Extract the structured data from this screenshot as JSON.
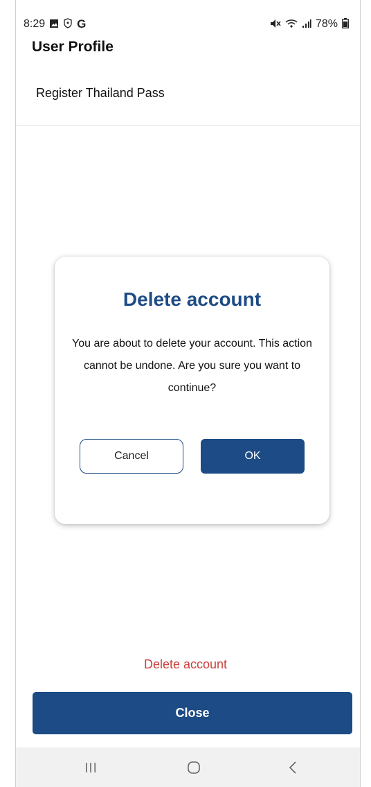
{
  "status_bar": {
    "time": "8:29",
    "battery": "78%",
    "icons": [
      "gallery-icon",
      "shield-icon",
      "google-icon",
      "mute-icon",
      "wifi-icon",
      "signal-icon",
      "battery-icon"
    ]
  },
  "header": {
    "title": "User Profile"
  },
  "menu": {
    "register_label": "Register Thailand Pass"
  },
  "dialog": {
    "title": "Delete account",
    "message": "You are about to delete your account. This action cannot be undone. Are you sure you want to continue?",
    "cancel_label": "Cancel",
    "ok_label": "OK"
  },
  "footer": {
    "delete_label": "Delete account",
    "close_label": "Close"
  },
  "colors": {
    "primary": "#1d4b85",
    "danger": "#c9413e",
    "nav_bg": "#f1f1f1"
  },
  "nav": {
    "icons": [
      "recents-icon",
      "home-icon",
      "back-icon"
    ]
  }
}
